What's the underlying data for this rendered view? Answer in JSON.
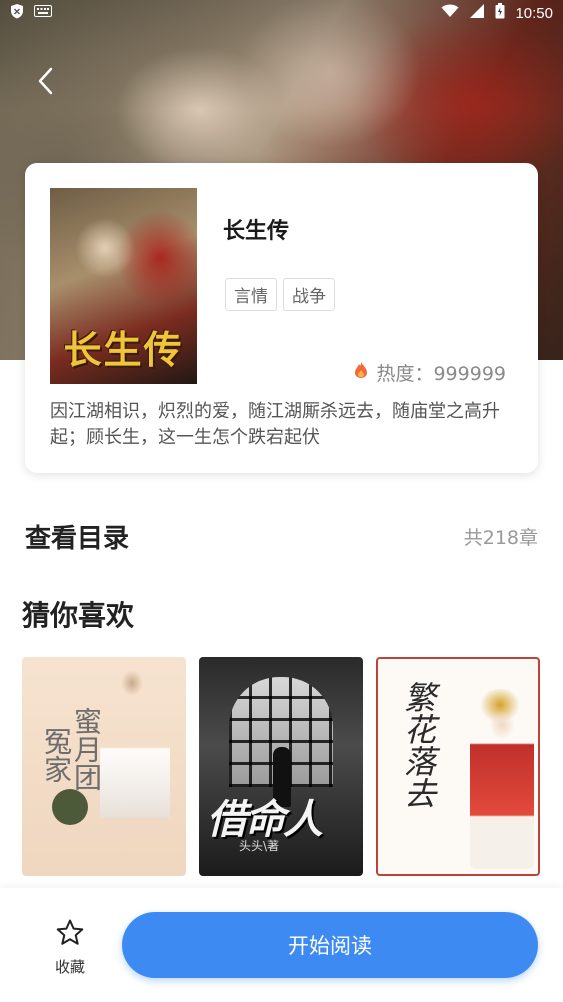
{
  "status_bar": {
    "time": "10:50"
  },
  "book": {
    "title": "长生传",
    "cover_title": "长生传",
    "tags": [
      "言情",
      "战争"
    ],
    "heat_label": "热度：999999",
    "synopsis": "因江湖相识，炽烈的爱，随江湖厮杀远去，随庙堂之高升起；顾长生，这一生怎个跌宕起伏"
  },
  "catalog": {
    "title": "查看目录",
    "count": "共218章"
  },
  "recommend": {
    "title": "猜你喜欢",
    "items": [
      {
        "cover_text_1": "冤家",
        "cover_text_2": "蜜月团"
      },
      {
        "cover_title": "借命人",
        "cover_author": "头头\\著"
      },
      {
        "cover_title": "繁花落去"
      }
    ]
  },
  "bottom_bar": {
    "favorite_label": "收藏",
    "read_button_label": "开始阅读"
  },
  "colors": {
    "accent": "#3d8bf2",
    "heat_icon": "#f06a3a"
  }
}
